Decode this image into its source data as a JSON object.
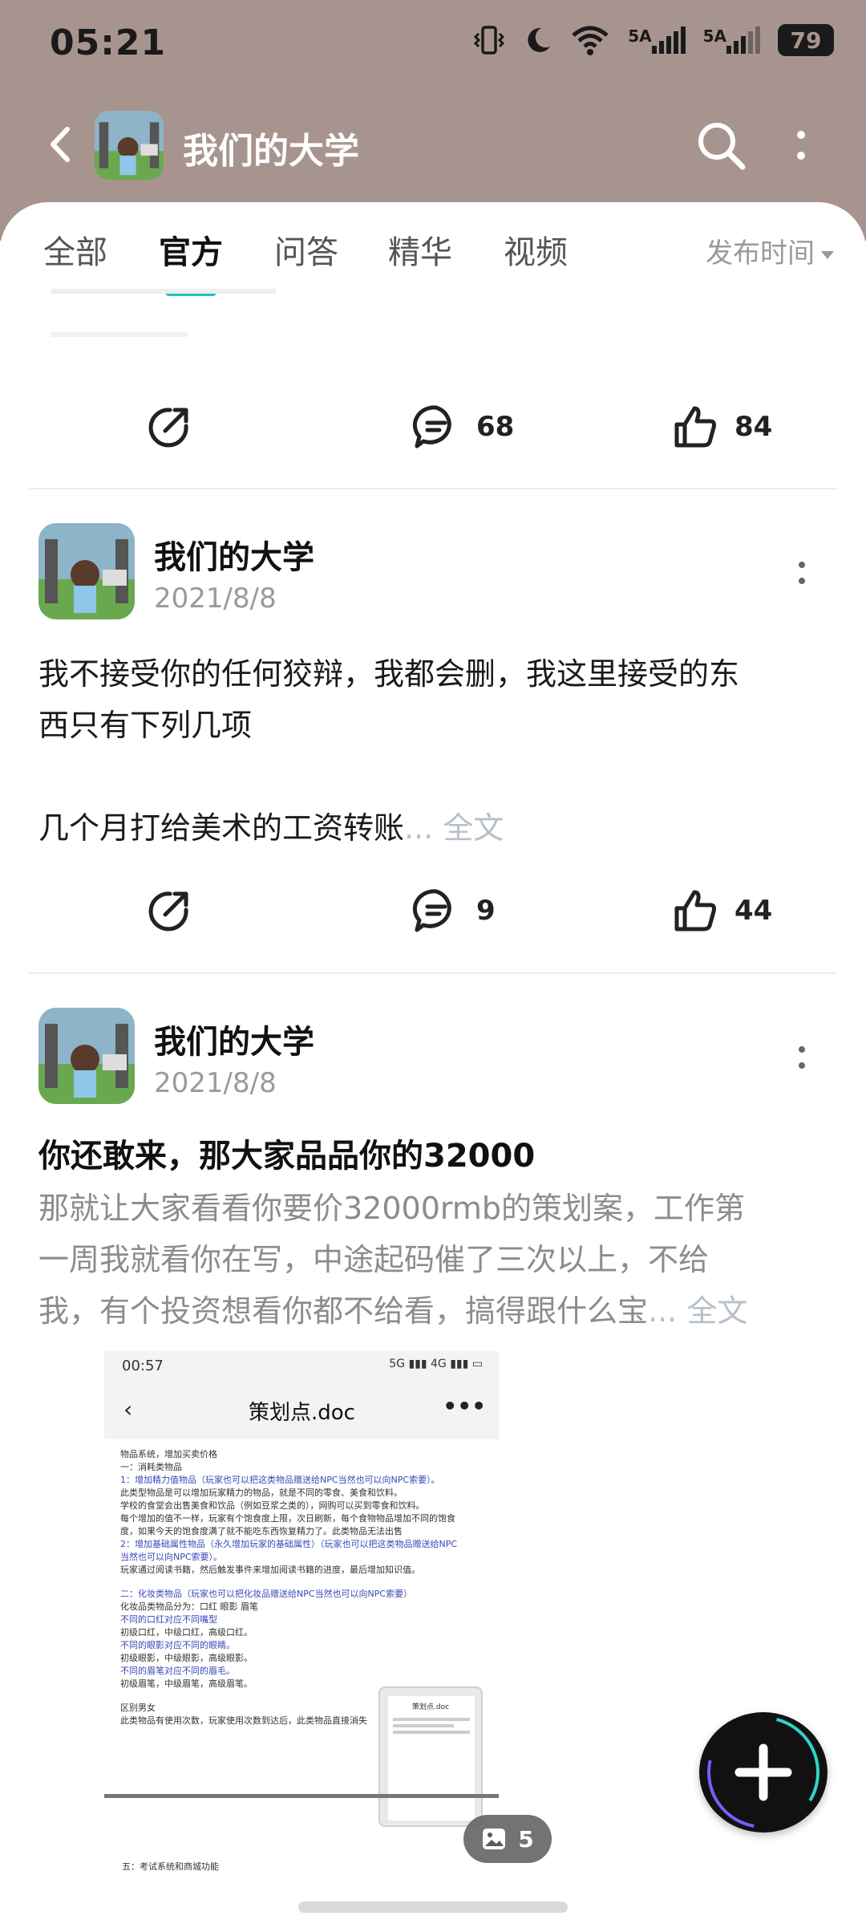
{
  "status_bar": {
    "time": "05:21",
    "battery": "79",
    "net1": "5A",
    "net2": "5A"
  },
  "header": {
    "title": "我们的大学"
  },
  "tabs": [
    {
      "label": "全部"
    },
    {
      "label": "官方"
    },
    {
      "label": "问答"
    },
    {
      "label": "精华"
    },
    {
      "label": "视频"
    }
  ],
  "sort": {
    "label": "发布时间"
  },
  "post0": {
    "comments": "68",
    "likes": "84"
  },
  "post1": {
    "author": "我们的大学",
    "date": "2021/8/8",
    "text_line1": "我不接受你的任何狡辩，我都会删，我这里接受的东",
    "text_line2": "西只有下列几项",
    "text_line3": "几个月打给美术的工资转账",
    "more": "... 全文",
    "comments": "9",
    "likes": "44"
  },
  "post2": {
    "author": "我们的大学",
    "date": "2021/8/8",
    "title": "你还敢来，那大家品品你的32000",
    "text_line1": "那就让大家看看你要价32000rmb的策划案，工作第",
    "text_line2": "一周我就看你在写，中途起码催了三次以上，不给",
    "text_line3": "我，有个投资想看你都不给看，搞得跟什么宝",
    "more": "... 全文",
    "image_count": "5"
  },
  "doc_image": {
    "time": "00:57",
    "title": "策划点.doc",
    "lines": [
      {
        "text": "物品系统，增加买卖价格",
        "blue": false
      },
      {
        "text": "一：消耗类物品",
        "blue": false
      },
      {
        "text": "1：增加精力值物品（玩家也可以把这类物品赠送给NPC当然也可以向NPC索要）。",
        "blue": true
      },
      {
        "text": "此类型物品是可以增加玩家精力的物品，就是不同的零食、美食和饮料。",
        "blue": false
      },
      {
        "text": "学校的食堂会出售美食和饮品（例如豆浆之类的），网购可以买到零食和饮料。",
        "blue": false
      },
      {
        "text": "每个增加的值不一样，玩家有个饱食度上限，次日刷新，每个食物物品增加不同的饱食",
        "blue": false
      },
      {
        "text": "度，如果今天的饱食度满了就不能吃东西恢复精力了。此类物品无法出售",
        "blue": false
      },
      {
        "text": "2：增加基础属性物品（永久增加玩家的基础属性）（玩家也可以把这类物品赠送给NPC",
        "blue": true
      },
      {
        "text": "当然也可以向NPC索要）。",
        "blue": true
      },
      {
        "text": "玩家通过阅读书籍，然后触发事件来增加阅读书籍的进度，最后增加知识值。",
        "blue": false
      },
      {
        "text": "二：化妆类物品（玩家也可以把化妆品赠送给NPC当然也可以向NPC索要）",
        "blue": true
      },
      {
        "text": "化妆品类物品分为：口红  眼影  眉笔",
        "blue": false
      },
      {
        "text": "不同的口红对应不同嘴型",
        "blue": true
      },
      {
        "text": "初级口红，中级口红，高级口红。",
        "blue": false
      },
      {
        "text": "不同的眼影对应不同的眼睛。",
        "blue": true
      },
      {
        "text": "初级眼影，中级眼影，高级眼影。",
        "blue": false
      },
      {
        "text": "不同的眉笔对应不同的眉毛。",
        "blue": true
      },
      {
        "text": "初级眉笔，中级眉笔，高级眉笔。",
        "blue": false
      },
      {
        "text": "区别男女",
        "blue": false
      },
      {
        "text": "此类物品有使用次数，玩家使用次数到达后，此类物品直接消失",
        "blue": false
      }
    ],
    "footer": "五：考试系统和商城功能",
    "mini_title": "策划点.doc"
  }
}
